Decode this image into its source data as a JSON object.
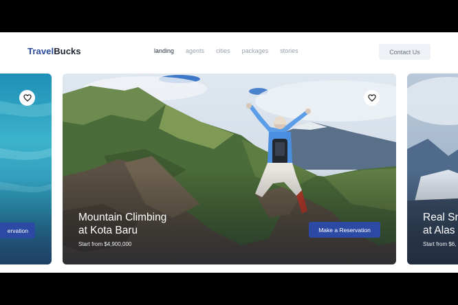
{
  "brand": {
    "part1": "Travel",
    "part2": "Bucks"
  },
  "nav": {
    "items": [
      {
        "label": "landing",
        "active": true
      },
      {
        "label": "agents",
        "active": false
      },
      {
        "label": "cities",
        "active": false
      },
      {
        "label": "packages",
        "active": false
      },
      {
        "label": "stories",
        "active": false
      }
    ]
  },
  "header": {
    "contact_label": "Contact Us"
  },
  "cards": [
    {
      "position": "left",
      "title": "",
      "price": "",
      "reserve_label": "ervation",
      "favorite_icon": "heart-icon"
    },
    {
      "position": "main",
      "title_line1": "Mountain Climbing",
      "title_line2": "at Kota Baru",
      "price": "Start from $4,900,000",
      "reserve_label": "Make a Reservation",
      "favorite_icon": "heart-icon"
    },
    {
      "position": "right",
      "title_line1": "Real Sn",
      "title_line2": "at Alas",
      "price": "Start from $6,",
      "reserve_label": ""
    }
  ],
  "colors": {
    "brand_blue": "#2a4a9b",
    "button_blue": "#2c4aa3",
    "contact_bg": "#eef1f5"
  }
}
